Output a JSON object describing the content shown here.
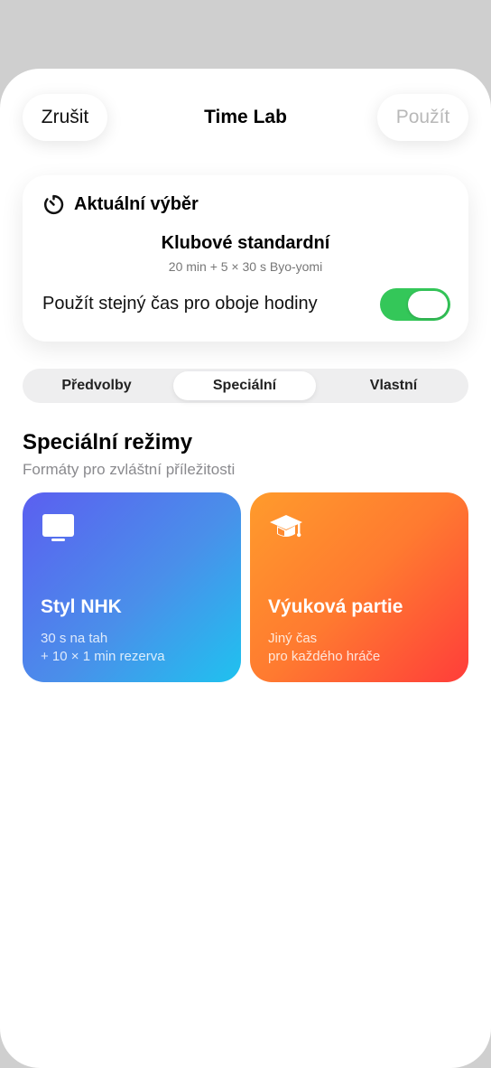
{
  "nav": {
    "cancel_label": "Zrušit",
    "title": "Time Lab",
    "apply_label": "Použít"
  },
  "current": {
    "header": "Aktuální výběr",
    "icon": "timer-icon",
    "preset_name": "Klubové standardní",
    "preset_desc": "20 min + 5 × 30 s Byo-yomi",
    "same_time_label": "Použít stejný čas pro oboje hodiny",
    "same_time_enabled": true
  },
  "tabs": [
    {
      "label": "Předvolby",
      "selected": false
    },
    {
      "label": "Speciální",
      "selected": true
    },
    {
      "label": "Vlastní",
      "selected": false
    }
  ],
  "section": {
    "title": "Speciální režimy",
    "subtitle": "Formáty pro zvláštní příležitosti"
  },
  "modes": [
    {
      "title": "Styl NHK",
      "line1": "30 s na tah",
      "line2": "+ 10 × 1 min rezerva",
      "icon": "tv-icon",
      "colors": [
        "#5b5ff0",
        "#1fc2ef"
      ]
    },
    {
      "title": "Výuková partie",
      "line1": "Jiný čas",
      "line2": "pro každého hráče",
      "icon": "graduation-cap-icon",
      "colors": [
        "#ff9b2c",
        "#ff3d3a"
      ]
    }
  ],
  "colors": {
    "toggle_on": "#34c759",
    "apply_disabled": "#b8b8b8"
  }
}
